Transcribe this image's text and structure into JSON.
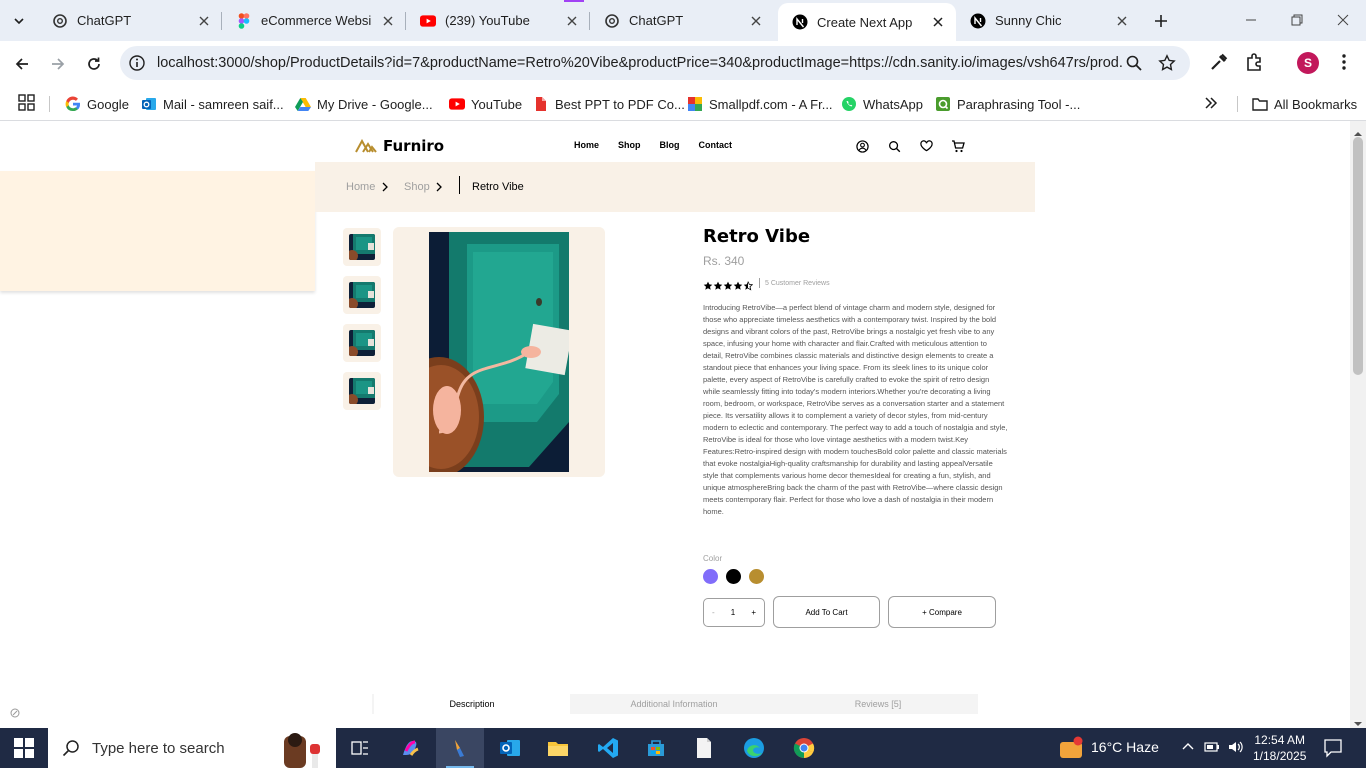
{
  "browser": {
    "tabs": [
      {
        "title": "ChatGPT",
        "icon": "chatgpt-icon"
      },
      {
        "title": "eCommerce Website",
        "icon": "figma-icon"
      },
      {
        "title": "(239) YouTube",
        "icon": "youtube-icon"
      },
      {
        "title": "ChatGPT",
        "icon": "chatgpt-icon"
      },
      {
        "title": "Create Next App",
        "icon": "nextjs-icon",
        "active": true
      },
      {
        "title": "Sunny Chic",
        "icon": "nextjs-icon"
      }
    ],
    "url": "localhost:3000/shop/ProductDetails?id=7&productName=Retro%20Vibe&productPrice=340&productImage=https://cdn.sanity.io/images/vsh647rs/prod...",
    "profile_initial": "S",
    "bookmarks": [
      {
        "label": "Google",
        "icon": "google-icon"
      },
      {
        "label": "Mail - samreen saif...",
        "icon": "outlook-icon"
      },
      {
        "label": "My Drive - Google...",
        "icon": "drive-icon"
      },
      {
        "label": "YouTube",
        "icon": "youtube-icon"
      },
      {
        "label": "Best PPT to PDF Co...",
        "icon": "ilovepdf-icon"
      },
      {
        "label": "Smallpdf.com - A Fr...",
        "icon": "smallpdf-icon"
      },
      {
        "label": "WhatsApp",
        "icon": "whatsapp-icon"
      },
      {
        "label": "Paraphrasing Tool -...",
        "icon": "quillbot-icon"
      }
    ],
    "all_bookmarks": "All Bookmarks"
  },
  "site": {
    "logo": "Furniro",
    "nav": [
      "Home",
      "Shop",
      "Blog",
      "Contact"
    ],
    "breadcrumb": {
      "home": "Home",
      "shop": "Shop",
      "current": "Retro Vibe"
    }
  },
  "product": {
    "name": "Retro Vibe",
    "price": "Rs. 340",
    "rating": 4.5,
    "reviews": "5 Customer Reviews",
    "description": "Introducing RetroVibe—a perfect blend of vintage charm and modern style, designed for those who appreciate timeless aesthetics with a contemporary twist. Inspired by the bold designs and vibrant colors of the past, RetroVibe brings a nostalgic yet fresh vibe to any space, infusing your home with character and flair.Crafted with meticulous attention to detail, RetroVibe combines classic materials and distinctive design elements to create a standout piece that enhances your living space. From its sleek lines to its unique color palette, every aspect of RetroVibe is carefully crafted to evoke the spirit of retro design while seamlessly fitting into today's modern interiors.Whether you're decorating a living room, bedroom, or workspace, RetroVibe serves as a conversation starter and a statement piece. Its versatility allows it to complement a variety of decor styles, from mid-century modern to eclectic and contemporary. The perfect way to add a touch of nostalgia and style, RetroVibe is ideal for those who love vintage aesthetics with a modern twist.Key Features:Retro-inspired design with modern touchesBold color palette and classic materials that evoke nostalgiaHigh-quality craftsmanship for durability and lasting appealVersatile style that complements various home decor themesIdeal for creating a fun, stylish, and unique atmosphereBring back the charm of the past with RetroVibe—where classic design meets contemporary flair. Perfect for those who love a dash of nostalgia in their modern home.",
    "color_label": "Color",
    "colors": [
      "#816dfa",
      "#000000",
      "#b88e2f"
    ],
    "quantity": "1",
    "minus": "-",
    "plus": "+",
    "add_to_cart": "Add To Cart",
    "compare": "+ Compare"
  },
  "product_tabs": [
    "Description",
    "Additional Information",
    "Reviews [5]"
  ],
  "taskbar": {
    "search_placeholder": "Type here to search",
    "weather": "16°C  Haze",
    "time": "12:54 AM",
    "date": "1/18/2025"
  }
}
